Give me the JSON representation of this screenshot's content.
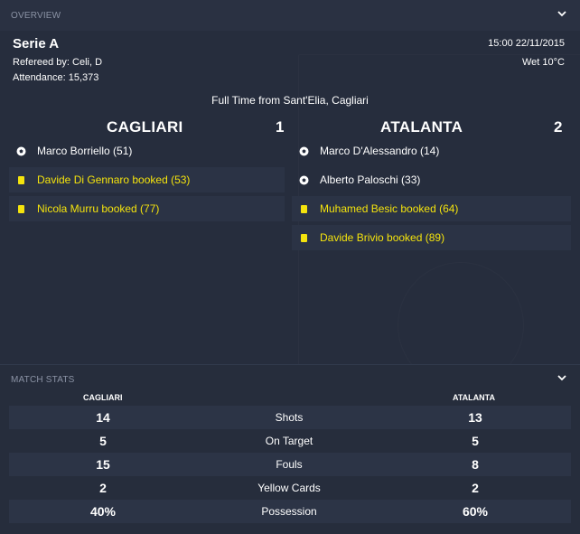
{
  "overview": {
    "section_title": "OVERVIEW",
    "competition": "Serie A",
    "referee": "Refereed by: Celi, D",
    "attendance": "Attendance: 15,373",
    "kickoff": "15:00 22/11/2015",
    "weather": "Wet 10°C",
    "status": "Full Time from Sant'Elia, Cagliari",
    "home": {
      "name": "CAGLIARI",
      "score": "1",
      "events": [
        {
          "type": "goal",
          "icon": "football-icon",
          "text": "Marco Borriello (51)"
        },
        {
          "type": "card",
          "icon": "yellow-card-icon",
          "text": "Davide Di Gennaro booked (53)"
        },
        {
          "type": "card",
          "icon": "yellow-card-icon",
          "text": "Nicola Murru booked (77)"
        }
      ]
    },
    "away": {
      "name": "ATALANTA",
      "score": "2",
      "events": [
        {
          "type": "goal",
          "icon": "football-icon",
          "text": "Marco D'Alessandro (14)"
        },
        {
          "type": "goal",
          "icon": "football-icon",
          "text": "Alberto Paloschi (33)"
        },
        {
          "type": "card",
          "icon": "yellow-card-icon",
          "text": "Muhamed Besic booked (64)"
        },
        {
          "type": "card",
          "icon": "yellow-card-icon",
          "text": "Davide Brivio booked (89)"
        }
      ]
    }
  },
  "stats": {
    "section_title": "MATCH STATS",
    "home_label": "CAGLIARI",
    "away_label": "ATALANTA",
    "rows": [
      {
        "label": "Shots",
        "home": "14",
        "away": "13"
      },
      {
        "label": "On Target",
        "home": "5",
        "away": "5"
      },
      {
        "label": "Fouls",
        "home": "15",
        "away": "8"
      },
      {
        "label": "Yellow Cards",
        "home": "2",
        "away": "2"
      },
      {
        "label": "Possession",
        "home": "40%",
        "away": "60%"
      }
    ]
  },
  "colors": {
    "background": "#262d3d",
    "card_yellow": "#f4e30d",
    "muted_text": "#8b93a5"
  }
}
